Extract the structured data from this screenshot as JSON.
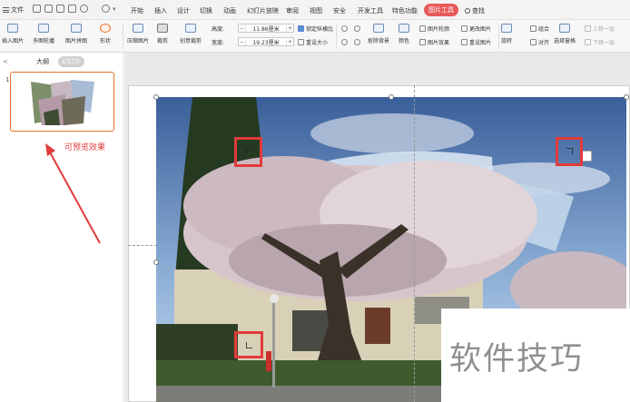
{
  "menubar": {
    "file_label": "文件",
    "items": [
      "开始",
      "插入",
      "设计",
      "切换",
      "动画",
      "幻灯片放映",
      "审阅",
      "视图",
      "安全",
      "开发工具",
      "特色功能"
    ],
    "active_tab": "图片工具",
    "search_label": "查找"
  },
  "ribbon": {
    "insert_picture": "插入图片",
    "multi_outline": "多图轮播",
    "picture_split": "图片拼图",
    "shape": "形状",
    "compress": "压缩图片",
    "crop": "裁剪",
    "creative_crop": "创意裁剪",
    "height_label": "高度:",
    "height_value": "11.86厘米",
    "width_label": "宽度:",
    "width_value": "19.23厘米",
    "lock_ratio": "锁定纵横比",
    "reset_size": "重设大小",
    "remove_bg": "抠除背景",
    "color": "颜色",
    "picture_outline": "图片轮廓",
    "picture_effect": "图片效果",
    "change_picture": "更改图片",
    "reset_picture": "重设图片",
    "rotate": "旋转",
    "align": "对齐",
    "group": "组合",
    "select_pane": "选择窗格",
    "bring_forward": "上移一层",
    "send_backward": "下移一层"
  },
  "left_panel": {
    "collapse_glyph": "<",
    "tab_outline": "大纲",
    "tab_slides": "幻灯片",
    "slide_number": "1",
    "annotation": "可预览效果"
  },
  "watermark": "软件技巧",
  "colors": {
    "accent": "#e8595b",
    "annotation": "#e23b3b",
    "thumb_border": "#e8722b"
  }
}
